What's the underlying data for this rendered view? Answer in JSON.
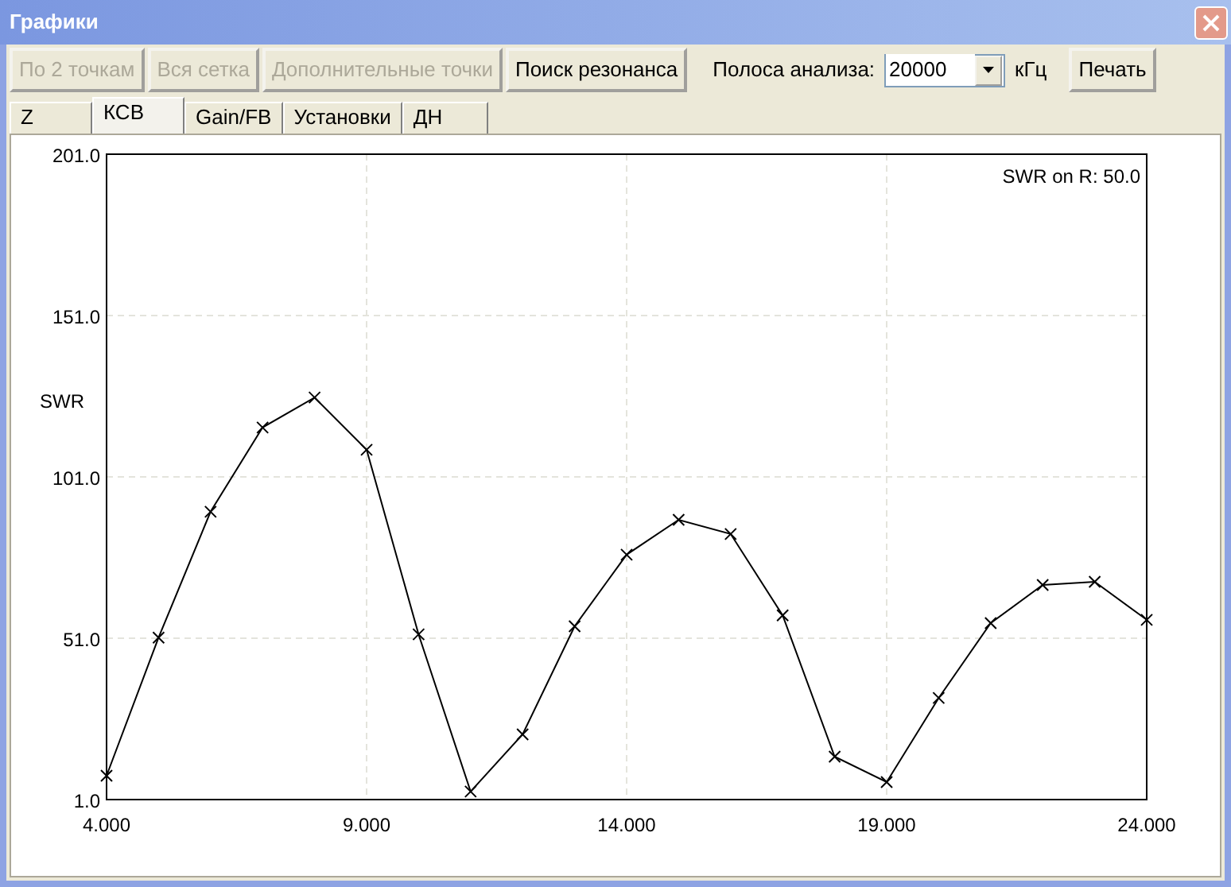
{
  "window": {
    "title": "Графики"
  },
  "toolbar": {
    "buttons": [
      {
        "label": "По 2 точкам",
        "disabled": true
      },
      {
        "label": "Вся сетка",
        "disabled": true
      },
      {
        "label": "Дополнительные точки",
        "disabled": true
      },
      {
        "label": "Поиск резонанса",
        "disabled": false
      }
    ],
    "band_label": "Полоса анализа:",
    "band_value": "20000",
    "band_unit": "кГц",
    "print_button": "Печать"
  },
  "tabs": [
    {
      "label": "Z",
      "selected": false
    },
    {
      "label": "КСВ",
      "selected": true
    },
    {
      "label": "Gain/FB",
      "selected": false
    },
    {
      "label": "Установки",
      "selected": false
    },
    {
      "label": "ДН",
      "selected": false
    }
  ],
  "chart": {
    "chart_data": {
      "type": "line",
      "ylabel": "SWR",
      "x": [
        4,
        5,
        6,
        7,
        8,
        9,
        10,
        11,
        12,
        13,
        14,
        15,
        16,
        17,
        18,
        19,
        20,
        21,
        22,
        23,
        24
      ],
      "grid": true,
      "series": [
        {
          "color": "#000000",
          "marker": "x",
          "values": [
            8.4,
            51.2,
            90.2,
            116.3,
            125.6,
            109.4,
            52.2,
            3.5,
            21.2,
            54.7,
            76.9,
            87.7,
            83.3,
            58.1,
            14.3,
            6.4,
            32.5,
            55.7,
            67.5,
            68.5,
            56.7
          ]
        }
      ],
      "xlim": [
        4,
        24
      ],
      "ylim": [
        1,
        201
      ],
      "xticks": [
        {
          "value": 4,
          "label": "4.000"
        },
        {
          "value": 9,
          "label": "9.000"
        },
        {
          "value": 14,
          "label": "14.000"
        },
        {
          "value": 19,
          "label": "19.000"
        },
        {
          "value": 24,
          "label": "24.000"
        }
      ],
      "yticks": [
        {
          "value": 1,
          "label": "1.0"
        },
        {
          "value": 51,
          "label": "51.0"
        },
        {
          "value": 101,
          "label": "101.0"
        },
        {
          "value": 151,
          "label": "151.0"
        },
        {
          "value": 201,
          "label": "201.0"
        }
      ],
      "annotations": [
        "SWR on R: 50.0"
      ]
    }
  }
}
